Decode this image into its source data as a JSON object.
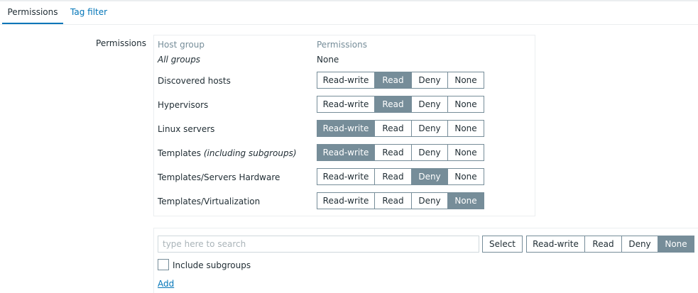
{
  "tabs": [
    {
      "label": "Permissions",
      "active": true
    },
    {
      "label": "Tag filter",
      "active": false
    }
  ],
  "form": {
    "label": "Permissions"
  },
  "table": {
    "columns": [
      "Host group",
      "Permissions"
    ],
    "all_groups": {
      "name": "All groups",
      "value": "None"
    },
    "options": [
      "Read-write",
      "Read",
      "Deny",
      "None"
    ],
    "rows": [
      {
        "name": "Discovered hosts",
        "note": "",
        "selected": "Read"
      },
      {
        "name": "Hypervisors",
        "note": "",
        "selected": "Read"
      },
      {
        "name": "Linux servers",
        "note": "",
        "selected": "Read-write"
      },
      {
        "name": "Templates",
        "note": "(including subgroups)",
        "selected": "Read-write"
      },
      {
        "name": "Templates/Servers Hardware",
        "note": "",
        "selected": "Deny"
      },
      {
        "name": "Templates/Virtualization",
        "note": "",
        "selected": "None"
      }
    ]
  },
  "add_form": {
    "search_placeholder": "type here to search",
    "search_value": "",
    "select_label": "Select",
    "options": [
      "Read-write",
      "Read",
      "Deny",
      "None"
    ],
    "selected": "None",
    "include_subgroups_label": "Include subgroups",
    "include_subgroups_checked": false,
    "add_label": "Add"
  },
  "colors": {
    "accent": "#0275b8",
    "selected_bg": "#768d99",
    "header_text": "#768d99",
    "border": "#ebeef0"
  }
}
